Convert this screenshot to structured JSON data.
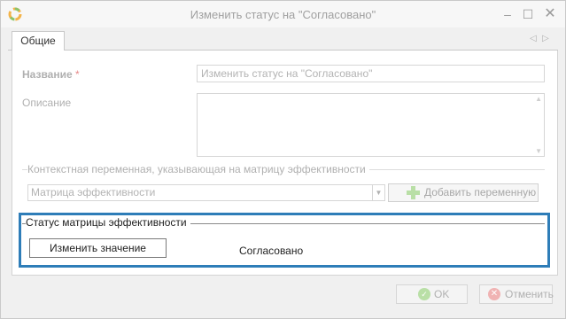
{
  "window": {
    "title": "Изменить статус на \"Согласовано\"",
    "controls": {
      "minimize": "–",
      "maximize": "☐",
      "close": "✕"
    }
  },
  "tabs": [
    {
      "label": "Общие",
      "active": true
    }
  ],
  "tab_nav": {
    "prev": "◁",
    "next": "▷"
  },
  "form": {
    "name_label": "Название",
    "required_mark": "*",
    "name_value": "Изменить статус на \"Согласовано\"",
    "description_label": "Описание",
    "description_value": "",
    "context_group_label": "Контекстная переменная, указывающая на матрицу эффективности",
    "matrix_select_value": "Матрица эффективности",
    "add_variable_button": "Добавить переменную",
    "status_group_label": "Статус матрицы эффективности",
    "change_value_button": "Изменить значение",
    "status_value": "Согласовано"
  },
  "footer": {
    "ok_button": "OK",
    "cancel_button": "Отменить"
  },
  "colors": {
    "highlight_border": "#2e7db8",
    "add_icon": "#b9dfa6",
    "ok_icon": "#b9dfa6",
    "cancel_icon": "#f0b3b3"
  },
  "icons": {
    "app": "app-logo-icon",
    "add": "plus-icon",
    "ok": "check-circle-icon",
    "cancel": "close-circle-icon"
  }
}
